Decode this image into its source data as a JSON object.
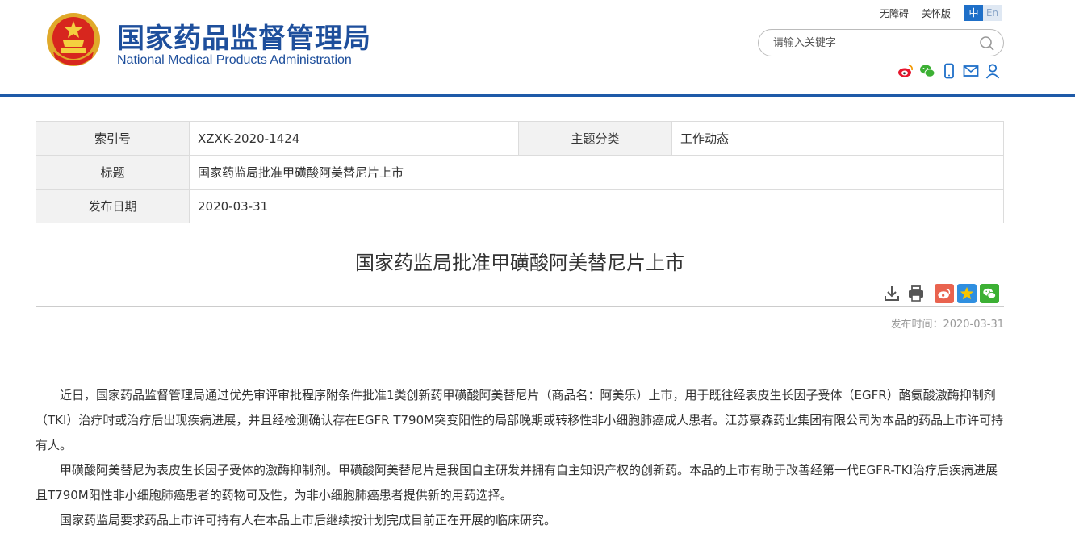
{
  "header": {
    "site_name_cn": "国家药品监督管理局",
    "site_name_en": "National Medical Products Administration",
    "accessibility_link": "无障碍",
    "care_mode_link": "关怀版",
    "lang_zh": "中",
    "lang_en": "En",
    "search_placeholder": "请输入关键字",
    "icons": [
      "weibo-icon",
      "wechat-icon",
      "mobile-icon",
      "mail-icon",
      "user-icon"
    ],
    "colors": {
      "brand": "#1e4f9c",
      "bar": "#1e5aa8"
    }
  },
  "info_table": {
    "index_label": "索引号",
    "index_value": "XZXK-2020-1424",
    "category_label": "主题分类",
    "category_value": "工作动态",
    "title_label": "标题",
    "title_value": "国家药监局批准甲磺酸阿美替尼片上市",
    "date_label": "发布日期",
    "date_value": "2020-03-31"
  },
  "article": {
    "title": "国家药监局批准甲磺酸阿美替尼片上市",
    "publish_time": "发布时间：2020-03-31",
    "tools": [
      "download-icon",
      "print-icon",
      "share-weibo-icon",
      "share-qzone-icon",
      "share-wechat-icon"
    ],
    "paragraphs": [
      "近日，国家药品监督管理局通过优先审评审批程序附条件批准1类创新药甲磺酸阿美替尼片（商品名：阿美乐）上市，用于既往经表皮生长因子受体（EGFR）酪氨酸激酶抑制剂（TKI）治疗时或治疗后出现疾病进展，并且经检测确认存在EGFR T790M突变阳性的局部晚期或转移性非小细胞肺癌成人患者。江苏豪森药业集团有限公司为本品的药品上市许可持有人。",
      "甲磺酸阿美替尼为表皮生长因子受体的激酶抑制剂。甲磺酸阿美替尼片是我国自主研发并拥有自主知识产权的创新药。本品的上市有助于改善经第一代EGFR-TKI治疗后疾病进展且T790M阳性非小细胞肺癌患者的药物可及性，为非小细胞肺癌患者提供新的用药选择。",
      "国家药监局要求药品上市许可持有人在本品上市后继续按计划完成目前正在开展的临床研究。"
    ]
  }
}
